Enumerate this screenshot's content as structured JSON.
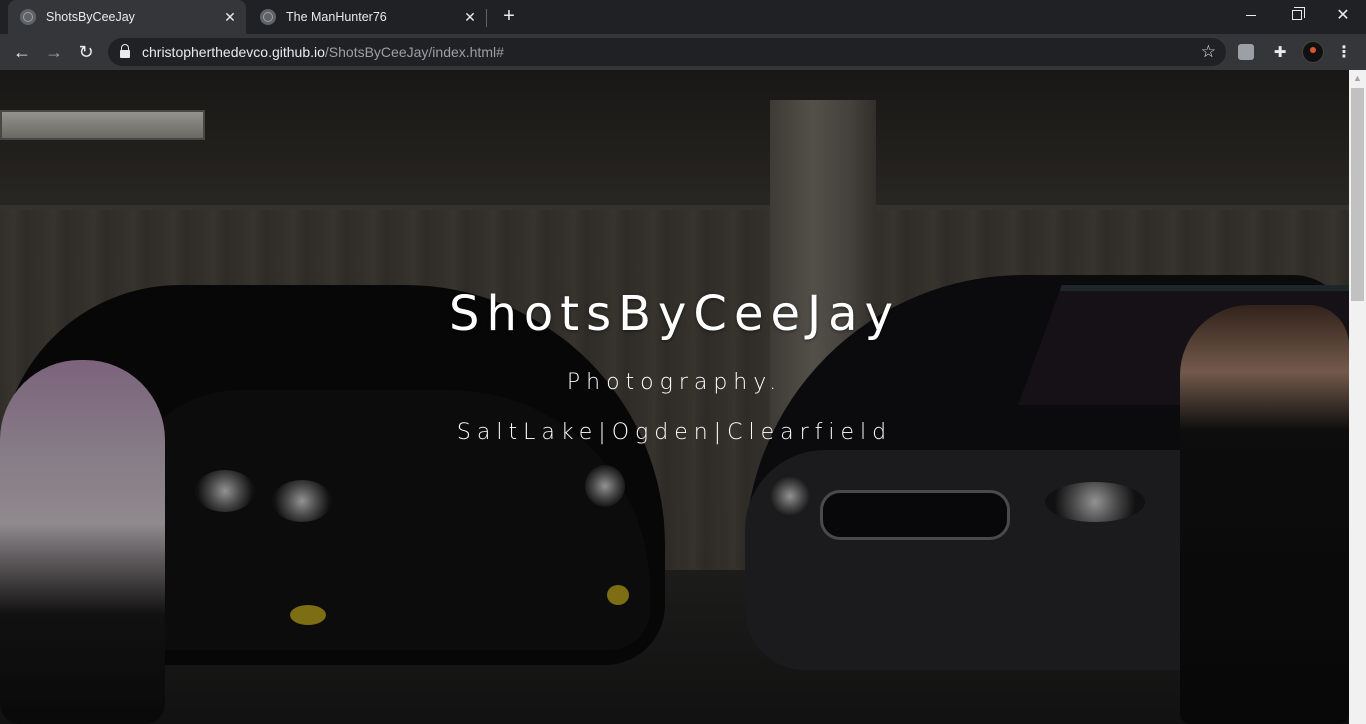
{
  "browser": {
    "tabs": [
      {
        "title": "ShotsByCeeJay",
        "active": true
      },
      {
        "title": "The ManHunter76",
        "active": false
      }
    ],
    "new_tab_label": "+",
    "close_glyph": "✕",
    "window_controls": {
      "close": "✕"
    },
    "address": {
      "host": "christopherthedevco.github.io",
      "path": "/ShotsByCeeJay/index.html#"
    },
    "nav": {
      "back": "←",
      "forward": "→",
      "reload": "↻"
    },
    "icons": [
      "back-arrow-icon",
      "forward-arrow-icon",
      "reload-icon",
      "lock-icon",
      "star-icon",
      "extension-icon",
      "puzzle-icon",
      "profile-avatar",
      "menu-dots-icon"
    ],
    "star": "☆",
    "puzzle": "✚",
    "menu": "⋮"
  },
  "hero": {
    "title": "ShotsByCeeJay",
    "subtitle": "Photography.",
    "cities": "SaltLake|Ogden|Clearfield"
  },
  "scrollbar": {
    "up_arrow": "▲"
  },
  "colors": {
    "tabstrip": "#202124",
    "toolbar": "#35363a",
    "omnibox": "#202124",
    "hero_text": "#ffffff"
  }
}
